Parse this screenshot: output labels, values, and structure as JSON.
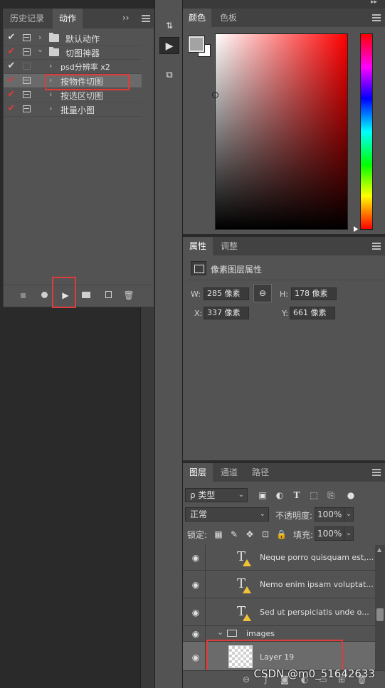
{
  "actions_panel": {
    "tabs": [
      {
        "label": "历史记录",
        "active": false
      },
      {
        "label": "动作",
        "active": true
      }
    ],
    "collapse_label": "››",
    "items": [
      {
        "check": "✔",
        "check_color": "white",
        "dialog": true,
        "expand": "›",
        "folder": true,
        "label": "默认动作",
        "indent": 0
      },
      {
        "check": "✔",
        "check_color": "red",
        "dialog": true,
        "expand": "⌄",
        "folder": true,
        "label": "切图神器",
        "indent": 0
      },
      {
        "check": "✔",
        "check_color": "white",
        "dialog": false,
        "expand": "›",
        "folder": false,
        "label": "psd分辨率 x2",
        "indent": 1
      },
      {
        "check": "✔",
        "check_color": "red",
        "dialog": true,
        "expand": "›",
        "folder": false,
        "label": "按物件切图",
        "indent": 1,
        "selected": true
      },
      {
        "check": "✔",
        "check_color": "red",
        "dialog": true,
        "expand": "›",
        "folder": false,
        "label": "按选区切图",
        "indent": 1
      },
      {
        "check": "✔",
        "check_color": "red",
        "dialog": true,
        "expand": "›",
        "folder": false,
        "label": "批量小图",
        "indent": 1
      }
    ],
    "bottom_buttons": [
      "stop-icon",
      "record-icon",
      "play-icon",
      "new-set-icon",
      "new-action-icon",
      "trash-icon"
    ]
  },
  "tool_strip": {
    "top_arrows": "◂◂",
    "right_arrows": "▸▸"
  },
  "color_panel": {
    "tabs": [
      {
        "label": "颜色",
        "active": true
      },
      {
        "label": "色板",
        "active": false
      }
    ],
    "foreground": "#a3a3a3",
    "background": "#ffffff",
    "hue": "#ff0000"
  },
  "properties_panel": {
    "tabs": [
      {
        "label": "属性",
        "active": true
      },
      {
        "label": "调整",
        "active": false
      }
    ],
    "title": "像素图层属性",
    "w_label": "W:",
    "w_value": "285 像素",
    "h_label": "H:",
    "h_value": "178 像素",
    "x_label": "X:",
    "x_value": "337 像素",
    "y_label": "Y:",
    "y_value": "661 像素"
  },
  "layers_panel": {
    "tabs": [
      {
        "label": "图层",
        "active": true
      },
      {
        "label": "通道",
        "active": false
      },
      {
        "label": "路径",
        "active": false
      }
    ],
    "filter_label": "ρ 类型",
    "blend_mode": "正常",
    "opacity_label": "不透明度:",
    "opacity_value": "100%",
    "lock_label": "锁定:",
    "fill_label": "填充:",
    "fill_value": "100%",
    "layers": [
      {
        "type": "text",
        "name": "Neque porro quisquam est,..."
      },
      {
        "type": "text",
        "name": "Nemo enim ipsam voluptat..."
      },
      {
        "type": "text",
        "name": "Sed ut perspiciatis unde o..."
      },
      {
        "type": "group",
        "name": "images"
      },
      {
        "type": "pixel",
        "name": "Layer 19",
        "selected": true
      }
    ]
  },
  "watermark": "CSDN @m0_51642633"
}
